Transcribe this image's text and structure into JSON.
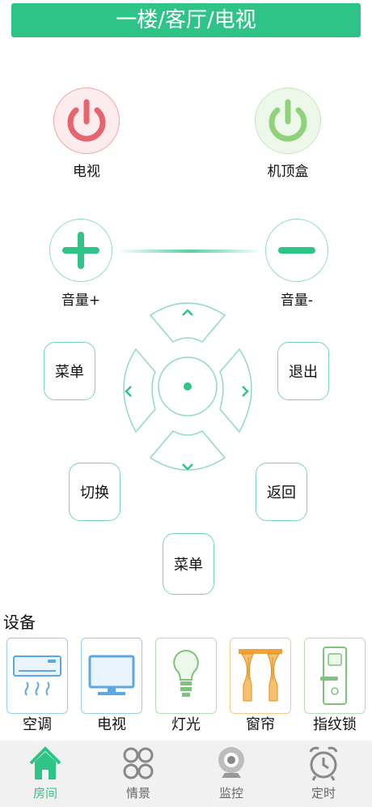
{
  "header": {
    "title": "一楼/客厅/电视"
  },
  "power": {
    "tv_label": "电视",
    "stb_label": "机顶盒"
  },
  "volume": {
    "up_label": "音量+",
    "down_label": "音量-"
  },
  "controls": {
    "menu_left": "菜单",
    "exit": "退出",
    "switch": "切换",
    "back": "返回",
    "menu_bottom": "菜单"
  },
  "devices": {
    "title": "设备",
    "items": [
      {
        "label": "空调",
        "icon": "air-conditioner-icon",
        "color": "#5aa9e6"
      },
      {
        "label": "电视",
        "icon": "tv-icon",
        "color": "#5aa9e6"
      },
      {
        "label": "灯光",
        "icon": "bulb-icon",
        "color": "#7cc47a"
      },
      {
        "label": "窗帘",
        "icon": "curtain-icon",
        "color": "#f0a23a"
      },
      {
        "label": "指纹锁",
        "icon": "fingerprint-lock-icon",
        "color": "#7cc47a"
      }
    ]
  },
  "tabs": [
    {
      "label": "房间",
      "icon": "home-icon",
      "active": true
    },
    {
      "label": "情景",
      "icon": "scene-icon",
      "active": false
    },
    {
      "label": "监控",
      "icon": "camera-icon",
      "active": false
    },
    {
      "label": "定时",
      "icon": "alarm-clock-icon",
      "active": false
    }
  ],
  "colors": {
    "accent": "#2ec488",
    "power_tv": "#e8636e",
    "power_stb": "#8fd27a"
  }
}
